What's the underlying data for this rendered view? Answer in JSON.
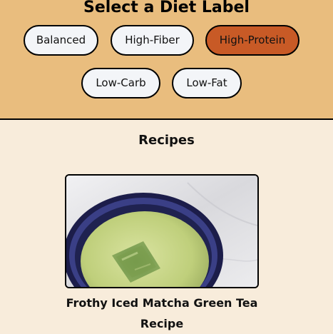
{
  "diet_section": {
    "title": "Select a Diet Label",
    "labels": [
      {
        "label": "Balanced",
        "selected": false
      },
      {
        "label": "High-Fiber",
        "selected": false
      },
      {
        "label": "High-Protein",
        "selected": true
      },
      {
        "label": "Low-Carb",
        "selected": false
      },
      {
        "label": "Low-Fat",
        "selected": false
      }
    ]
  },
  "recipes_section": {
    "heading": "Recipes",
    "items": [
      {
        "title": "Frothy Iced Matcha Green Tea Recipe"
      }
    ]
  },
  "colors": {
    "header_background": "#e9bd7e",
    "page_background": "#f8ecdb",
    "button_background": "#f3f5f8",
    "selected_button_background": "#c85a26",
    "border": "#000000"
  }
}
